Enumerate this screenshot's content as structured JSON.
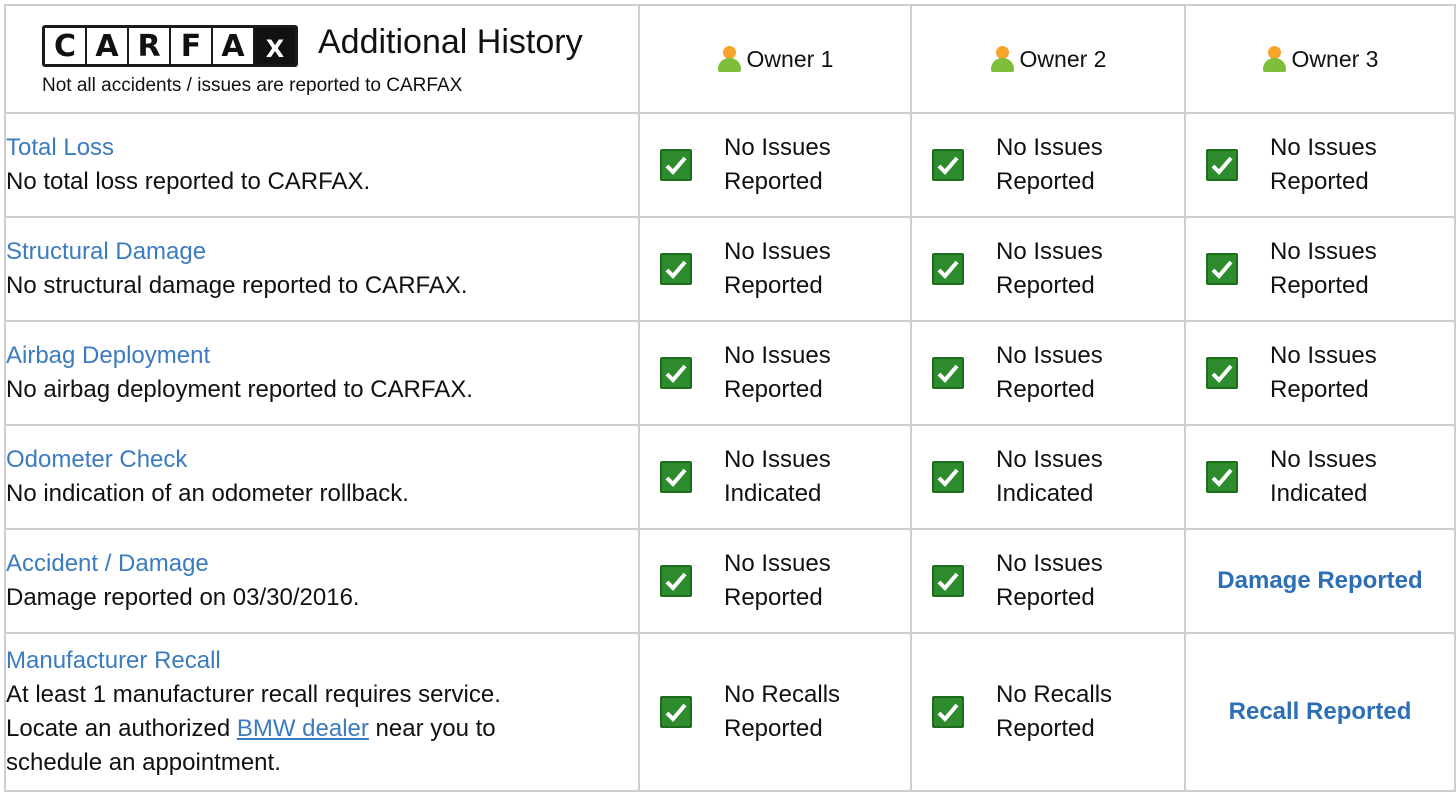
{
  "header": {
    "logo_letters": [
      "C",
      "A",
      "R",
      "F",
      "A",
      "X"
    ],
    "title": "Additional History",
    "disclaimer": "Not all accidents / issues are reported to CARFAX",
    "owners": [
      "Owner 1",
      "Owner 2",
      "Owner 3"
    ]
  },
  "rows": [
    {
      "title": "Total Loss",
      "desc": "No total loss reported to CARFAX.",
      "cells": [
        {
          "line1": "No Issues",
          "line2": "Reported"
        },
        {
          "line1": "No Issues",
          "line2": "Reported"
        },
        {
          "line1": "No Issues",
          "line2": "Reported"
        }
      ]
    },
    {
      "title": "Structural Damage",
      "desc": "No structural damage reported to CARFAX.",
      "cells": [
        {
          "line1": "No Issues",
          "line2": "Reported"
        },
        {
          "line1": "No Issues",
          "line2": "Reported"
        },
        {
          "line1": "No Issues",
          "line2": "Reported"
        }
      ]
    },
    {
      "title": "Airbag Deployment",
      "desc": "No airbag deployment reported to CARFAX.",
      "cells": [
        {
          "line1": "No Issues",
          "line2": "Reported"
        },
        {
          "line1": "No Issues",
          "line2": "Reported"
        },
        {
          "line1": "No Issues",
          "line2": "Reported"
        }
      ]
    },
    {
      "title": "Odometer Check",
      "desc": "No indication of an odometer rollback.",
      "cells": [
        {
          "line1": "No Issues",
          "line2": "Indicated"
        },
        {
          "line1": "No Issues",
          "line2": "Indicated"
        },
        {
          "line1": "No Issues",
          "line2": "Indicated"
        }
      ]
    },
    {
      "title": "Accident / Damage",
      "desc": "Damage reported on 03/30/2016.",
      "cells": [
        {
          "line1": "No Issues",
          "line2": "Reported"
        },
        {
          "line1": "No Issues",
          "line2": "Reported"
        }
      ],
      "alert": "Damage Reported"
    },
    {
      "title": "Manufacturer Recall",
      "desc_line1": "At least 1 manufacturer recall requires service.",
      "desc_pre": "Locate an authorized ",
      "desc_link": "BMW dealer",
      "desc_post": " near you to",
      "desc_line3": "schedule an appointment.",
      "cells": [
        {
          "line1": "No Recalls",
          "line2": "Reported"
        },
        {
          "line1": "No Recalls",
          "line2": "Reported"
        }
      ],
      "alert": "Recall Reported"
    }
  ],
  "colors": {
    "link": "#3b7bbf",
    "alert": "#2c6fb7",
    "check_green": "#2e8b2e",
    "border": "#cfcfcf"
  },
  "icons": {
    "owner": "person-icon",
    "status_ok": "checkmark-icon"
  }
}
